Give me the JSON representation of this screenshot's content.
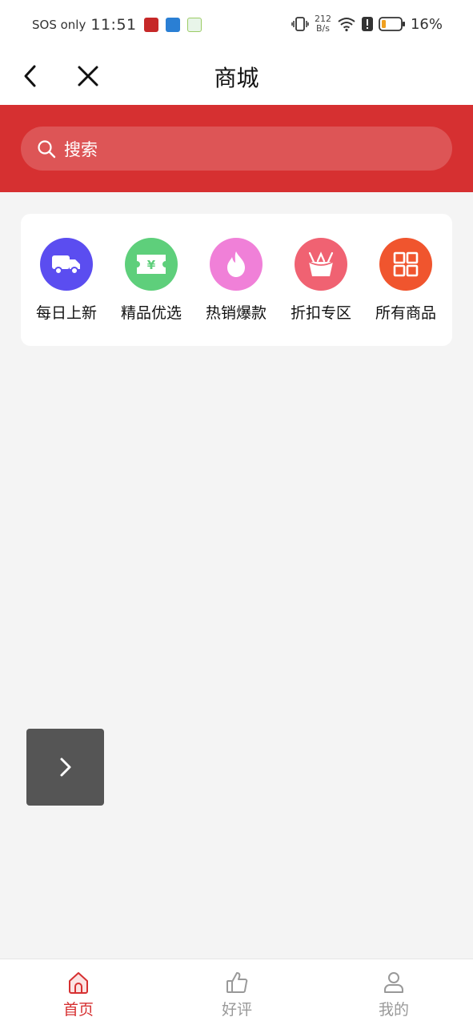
{
  "status_bar": {
    "carrier": "SOS only",
    "time": "11:51",
    "speed_value": "212",
    "speed_unit": "B/s",
    "battery": "16%"
  },
  "nav": {
    "title": "商城"
  },
  "search": {
    "placeholder": "搜索"
  },
  "categories": [
    {
      "label": "每日上新",
      "icon": "truck-icon",
      "color": "#5b4df0"
    },
    {
      "label": "精品优选",
      "icon": "ticket-icon",
      "color": "#5ecf7b"
    },
    {
      "label": "热销爆款",
      "icon": "flame-icon",
      "color": "#f080d8"
    },
    {
      "label": "折扣专区",
      "icon": "basket-icon",
      "color": "#f06272"
    },
    {
      "label": "所有商品",
      "icon": "grid-icon",
      "color": "#f0552e"
    }
  ],
  "tabs": [
    {
      "label": "首页",
      "icon": "home-icon",
      "active": true
    },
    {
      "label": "好评",
      "icon": "thumbs-up-icon",
      "active": false
    },
    {
      "label": "我的",
      "icon": "user-icon",
      "active": false
    }
  ],
  "colors": {
    "brand_red": "#d63031",
    "tab_active": "#d63031",
    "tab_inactive": "#999999"
  }
}
